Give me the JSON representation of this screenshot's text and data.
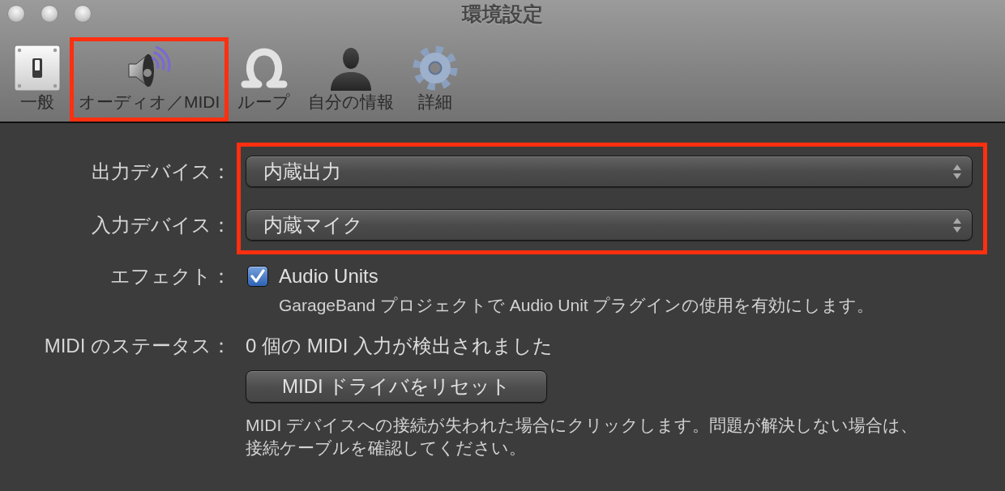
{
  "window": {
    "title": "環境設定"
  },
  "toolbar": {
    "items": [
      {
        "label": "一般",
        "highlighted": false
      },
      {
        "label": "オーディオ／MIDI",
        "highlighted": true
      },
      {
        "label": "ループ",
        "highlighted": false
      },
      {
        "label": "自分の情報",
        "highlighted": false
      },
      {
        "label": "詳細",
        "highlighted": false
      }
    ]
  },
  "devices": {
    "highlighted": true,
    "rows": [
      {
        "label": "出力デバイス：",
        "value": "内蔵出力"
      },
      {
        "label": "入力デバイス：",
        "value": "内蔵マイク"
      }
    ]
  },
  "effects": {
    "label": "エフェクト：",
    "checkbox": {
      "label": "Audio Units",
      "checked": true
    },
    "description": "GarageBand プロジェクトで Audio Unit プラグインの使用を有効にします。"
  },
  "midi": {
    "label": "MIDI のステータス：",
    "status": "0 個の MIDI 入力が検出されました",
    "button": "MIDI ドライバをリセット",
    "description": "MIDI デバイスへの接続が失われた場合にクリックします。問題が解決しない場合は、接続ケーブルを確認してください。"
  }
}
